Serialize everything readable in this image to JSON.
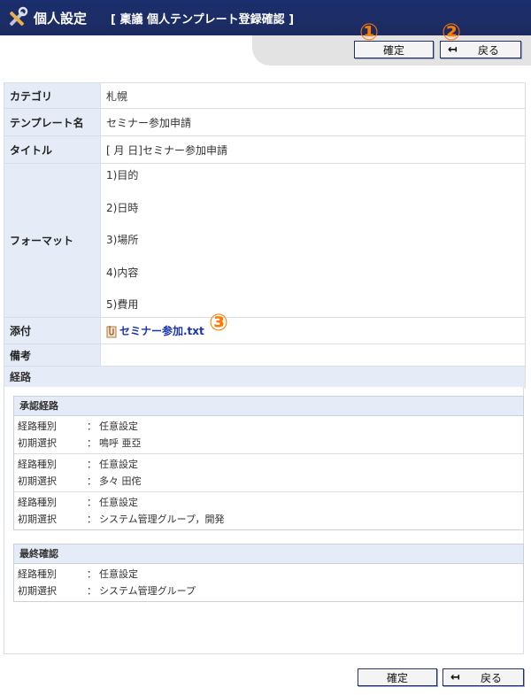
{
  "header": {
    "title": "個人設定",
    "subtitle": "[ 稟議 個人テンプレート登録確認 ]"
  },
  "buttons": {
    "confirm": "確定",
    "back": "戻る"
  },
  "markers": [
    "①",
    "②",
    "③"
  ],
  "form": {
    "category_label": "カテゴリ",
    "category_value": "札幌",
    "template_name_label": "テンプレート名",
    "template_name_value": "セミナー参加申請",
    "title_label": "タイトル",
    "title_value": "[ 月 日]セミナー参加申請",
    "format_label": "フォーマット",
    "format_lines": [
      "1)目的",
      "2)日時",
      "3)場所",
      "4)内容",
      "5)費用"
    ],
    "attachment_label": "添付",
    "attachment_file": "セミナー参加.txt",
    "remarks_label": "備考",
    "route_label": "経路"
  },
  "approval_route": {
    "title": "承認経路",
    "type_key": "経路種別",
    "init_key": "初期選択",
    "colon": "：",
    "entries": [
      {
        "type": "任意設定",
        "init": "鳴呼 亜亞"
      },
      {
        "type": "任意設定",
        "init": "多々 田侘"
      },
      {
        "type": "任意設定",
        "init": "システム管理グループ，開発"
      }
    ]
  },
  "final_route": {
    "title": "最終確認",
    "entries": [
      {
        "type": "任意設定",
        "init": "システム管理グループ"
      }
    ]
  },
  "colors": {
    "header_bg": "#1c2a5f",
    "label_bg": "#e6ecf7",
    "marker": "#ff7a00",
    "link": "#1a34b0"
  },
  "icons": [
    "tools-icon",
    "back-arrow-icon",
    "paperclip-icon"
  ]
}
